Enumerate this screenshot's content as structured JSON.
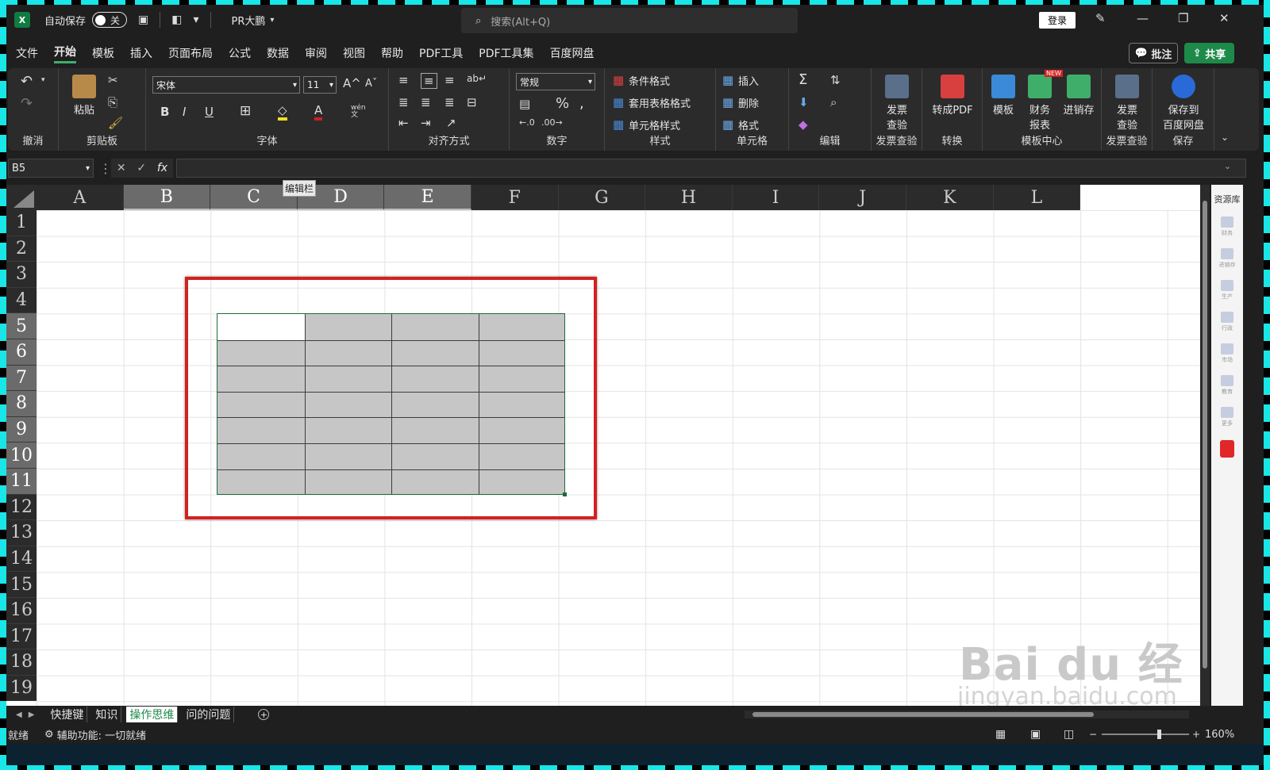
{
  "titlebar": {
    "autosave_label": "自动保存",
    "autosave_state": "关",
    "doc_name": "PR大鹏",
    "search_placeholder": "搜索(Alt+Q)",
    "login": "登录"
  },
  "menu": {
    "items": [
      "文件",
      "开始",
      "模板",
      "插入",
      "页面布局",
      "公式",
      "数据",
      "审阅",
      "视图",
      "帮助",
      "PDF工具",
      "PDF工具集",
      "百度网盘"
    ],
    "active": "开始",
    "comment": "批注",
    "share": "共享"
  },
  "ribbon": {
    "groups": {
      "undo": "撤消",
      "clipboard": "剪贴板",
      "font": "字体",
      "align": "对齐方式",
      "number": "数字",
      "style": "样式",
      "cells": "单元格",
      "edit": "编辑",
      "invoice": "发票查验",
      "convert": "转换",
      "template_center": "模板中心",
      "invoice2": "发票查验",
      "save": "保存"
    },
    "paste": "粘贴",
    "font_name": "宋体",
    "font_size": "11",
    "number_format": "常规",
    "cond_format": "条件格式",
    "table_format": "套用表格格式",
    "cell_style": "单元格样式",
    "insert": "插入",
    "delete": "删除",
    "format": "格式",
    "invoice_btn": "发票\n查验",
    "topdf": "转成PDF",
    "template": "模板",
    "finance": "财务\n报表",
    "jxc": "进销存",
    "invoice_btn2": "发票\n查验",
    "save_baidu": "保存到\n百度网盘",
    "new_badge": "NEW",
    "bold": "B",
    "italic": "I",
    "underline": "U",
    "wen": "wén\n文"
  },
  "formula_bar": {
    "name_box": "B5",
    "fx": "fx",
    "tooltip": "编辑栏"
  },
  "grid": {
    "columns": [
      "A",
      "B",
      "C",
      "D",
      "E",
      "F",
      "G",
      "H",
      "I",
      "J",
      "K",
      "L"
    ],
    "selected_columns": [
      "B",
      "C",
      "D",
      "E"
    ],
    "rows": [
      "1",
      "2",
      "3",
      "4",
      "5",
      "6",
      "7",
      "8",
      "9",
      "10",
      "11",
      "12",
      "13",
      "14",
      "15",
      "16",
      "17",
      "18",
      "19"
    ],
    "selected_rows": [
      "5",
      "6",
      "7",
      "8",
      "9",
      "10",
      "11"
    ],
    "selection_fill": "#c6c6c6",
    "highlight_color": "#d42020"
  },
  "side_panel": {
    "title": "资源库",
    "items": [
      "财务",
      "进销存",
      "生产",
      "行政",
      "市场",
      "教育",
      "更多"
    ]
  },
  "sheets": {
    "tabs": [
      "快捷键",
      "知识",
      "操作思维",
      "问的问题"
    ],
    "active": "操作思维"
  },
  "status": {
    "ready": "就绪",
    "accessibility": "辅助功能: 一切就绪",
    "zoom": "160%"
  },
  "watermark": {
    "brand": "Bai du 经验",
    "url": "jingyan.baidu.com"
  }
}
